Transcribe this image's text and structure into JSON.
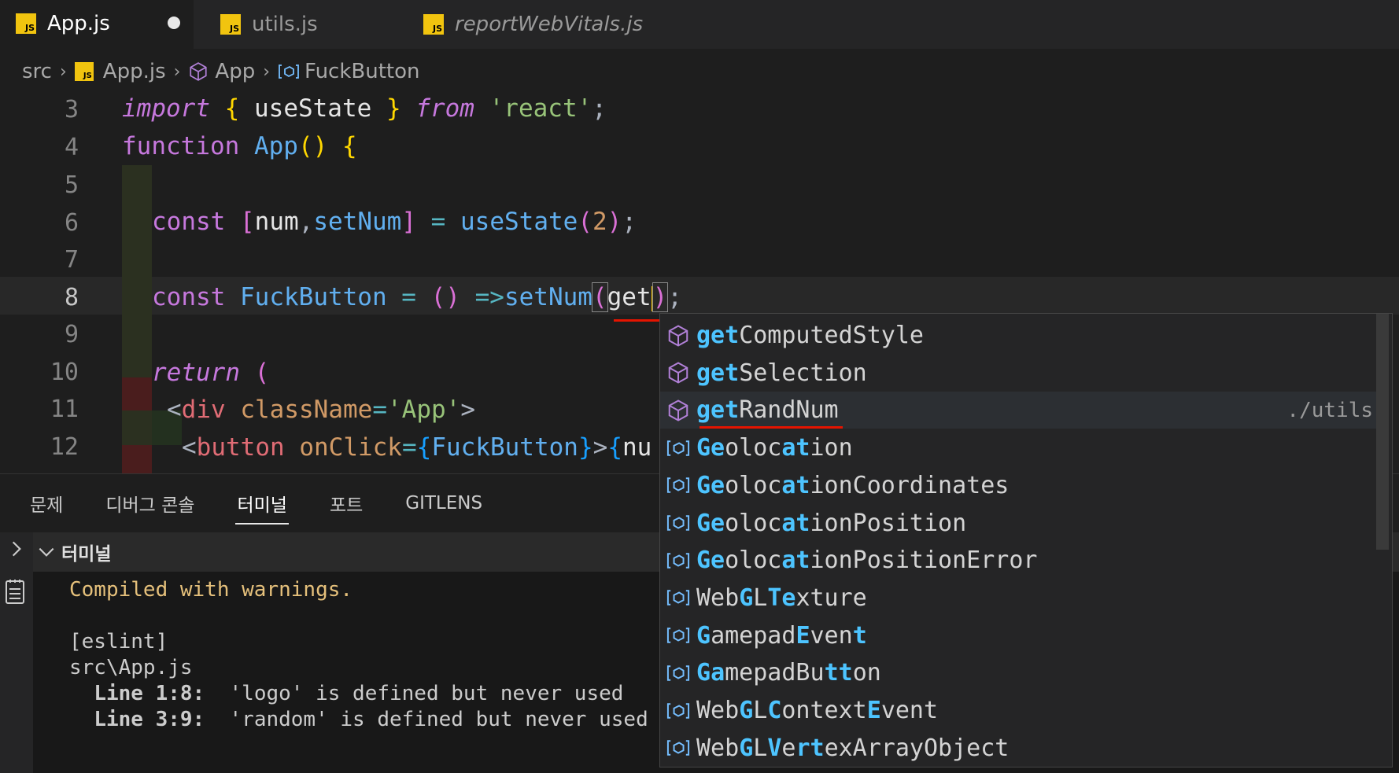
{
  "tabs": [
    {
      "label": "App.js",
      "active": true,
      "dirty": true,
      "icon": "js-file-icon"
    },
    {
      "label": "utils.js",
      "active": false,
      "icon": "js-file-icon"
    },
    {
      "label": "reportWebVitals.js",
      "active": false,
      "italic": true,
      "icon": "js-file-icon"
    }
  ],
  "js_badge": "JS",
  "breadcrumb": {
    "folder": "src",
    "file": "App.js",
    "symbol1": "App",
    "symbol2": "FuckButton"
  },
  "editor": {
    "lines": [
      {
        "n": "3"
      },
      {
        "n": "4"
      },
      {
        "n": "5"
      },
      {
        "n": "6"
      },
      {
        "n": "7"
      },
      {
        "n": "8"
      },
      {
        "n": "9"
      },
      {
        "n": "10"
      },
      {
        "n": "11"
      },
      {
        "n": "12"
      }
    ],
    "tok": {
      "import": "import",
      "lb": "{",
      "useState": " useState ",
      "rb": "}",
      "from": "from",
      "react": "'react'",
      "semi": ";",
      "function": "function",
      "App": "App",
      "parens": "()",
      "ob": "{",
      "const": "const",
      "lbr": "[",
      "num": "num",
      "comma": ",",
      "setNum": "setNum",
      "rbr": "]",
      "eq": " = ",
      "useStateCall": "useState",
      "lp": "(",
      "two": "2",
      "rp": ")",
      "FuckButton": "FuckButton",
      "arrowParens": "()",
      "arrow": " =>",
      "get": "get",
      "return": "return",
      "retParen": "(",
      "lt": "<",
      "div": "div",
      "className": "className",
      "eqs": "=",
      "appStr": "'App'",
      "gt": ">",
      "button": "button",
      "onClick": "onClick",
      "nu": "nu"
    }
  },
  "panel": {
    "tabs": [
      "문제",
      "디버그 콘솔",
      "터미널",
      "포트",
      "GITLENS"
    ],
    "active_tab": "터미널",
    "terminal_title": "터미널",
    "output": [
      "Compiled with warnings.",
      "",
      "[eslint]",
      "src\\App.js",
      "  Line 1:8:  'logo' is defined but never used",
      "  Line 3:9:  'random' is defined but never used"
    ],
    "bold_prefixes": [
      "Line 1:8:",
      "Line 3:9:"
    ]
  },
  "suggest": {
    "items": [
      {
        "kind": "cube-icon",
        "hl": "get",
        "rest": "ComputedStyle"
      },
      {
        "kind": "cube-icon",
        "hl": "get",
        "rest": "Selection"
      },
      {
        "kind": "cube-icon",
        "hl": "get",
        "rest": "RandNum",
        "detail": "./utils",
        "selected": true
      },
      {
        "kind": "variable-icon",
        "label": "Geolocation"
      },
      {
        "kind": "variable-icon",
        "label": "GeolocationCoordinates"
      },
      {
        "kind": "variable-icon",
        "label": "GeolocationPosition"
      },
      {
        "kind": "variable-icon",
        "label": "GeolocationPositionError"
      },
      {
        "kind": "variable-icon",
        "label": "WebGLTexture"
      },
      {
        "kind": "variable-icon",
        "label": "GamepadEvent"
      },
      {
        "kind": "variable-icon",
        "label": "GamepadButton"
      },
      {
        "kind": "variable-icon",
        "label": "WebGLContextEvent"
      },
      {
        "kind": "variable-icon",
        "label": "WebGLVertexArrayObject"
      }
    ]
  },
  "colors": {
    "accent": "#4dc4ff",
    "js_badge": "#f1c40f",
    "error_squiggle": "#e51400",
    "warning_text": "#e5c07b"
  }
}
